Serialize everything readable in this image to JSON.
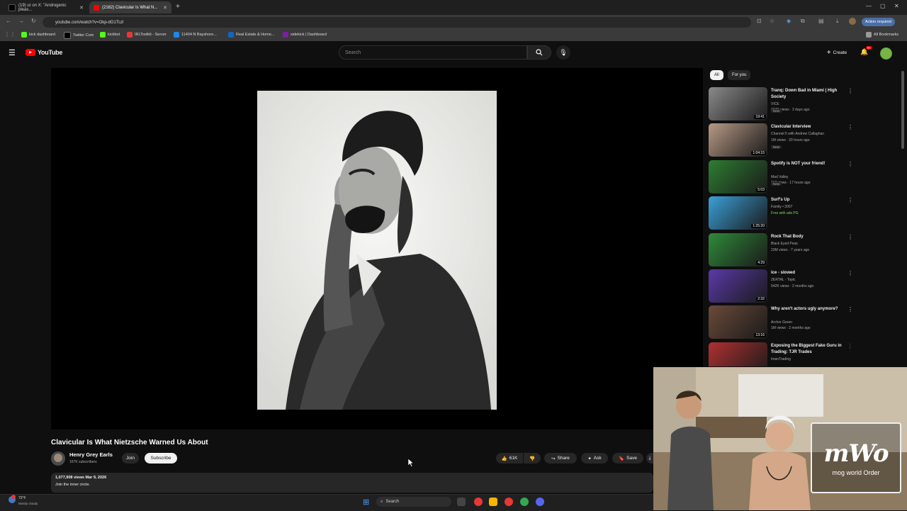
{
  "browser": {
    "tabs": [
      {
        "label": "(19) ur on X: \"Androgenic pleas...",
        "icon": "x-icon",
        "active": false
      },
      {
        "label": "(2162) Clavicular Is What N...",
        "icon": "youtube-icon",
        "active": true
      }
    ],
    "new_tab": "+",
    "url": "youtube.com/watch?v=Okp-dG1Tczl",
    "action_required": "Action required",
    "all_bookmarks": "All Bookmarks",
    "bookmarks": [
      "kick dashboard",
      "Twitter Com",
      "kickbot",
      "IRLToolkit - Server",
      "11404 N Bayshore...",
      "Real Estate & Home...",
      "sidekick | Dashboard"
    ]
  },
  "youtube": {
    "logo_text": "YouTube",
    "search_placeholder": "Search",
    "create_label": "Create",
    "notif_count": "9+"
  },
  "video": {
    "title": "Clavicular Is What Nietzsche Warned Us About",
    "channel": "Henry Grey Earls",
    "subscribers": "167K subscribers",
    "join": "Join",
    "subscribe": "Subscribe",
    "likes": "61K",
    "share": "Share",
    "ask": "Ask",
    "save": "Save",
    "stats": "1,077,908 views  Mar 9, 2026",
    "description": "Join the inner circle."
  },
  "sidebar": {
    "filters": [
      "All",
      "For you"
    ],
    "recommendations": [
      {
        "title": "Tranq: Down Bad in Miami | High Society",
        "channel": "VICE",
        "meta": "404K views · 2 days ago",
        "badge": "New",
        "duration": "19:41",
        "color": "#8a8a8a"
      },
      {
        "title": "Clavicular Interview",
        "channel": "Channel 5 with Andrew Callaghan",
        "meta": "1M views · 20 hours ago",
        "badge": "New",
        "duration": "1:04:15",
        "color": "#b89a86"
      },
      {
        "title": "Spotify is NOT your friend!",
        "channel": "Mad Valley",
        "meta": "113 views · 17 hours ago",
        "badge": "New",
        "duration": "5:03",
        "color": "#2e7d32"
      },
      {
        "title": "Surf's Up",
        "channel": "Family • 2007",
        "meta": "Free with ads  PG",
        "badge": "",
        "duration": "1:25:20",
        "color": "#3aa0d8"
      },
      {
        "title": "Rock That Body",
        "channel": "Black Eyed Peas",
        "meta": "23M views · 7 years ago",
        "badge": "",
        "duration": "4:29",
        "color": "#2f8a3a"
      },
      {
        "title": "ice - slowed",
        "channel": "ZERTAL - Topic",
        "meta": "542K views · 2 months ago",
        "badge": "",
        "duration": "2:32",
        "color": "#5a3aa8"
      },
      {
        "title": "Why aren't actors ugly anymore?",
        "channel": "Archer Green",
        "meta": "1M views · 2 months ago",
        "badge": "",
        "duration": "13:16",
        "color": "#6b4a3a"
      },
      {
        "title": "Exposing the Biggest Fake Guru in Trading: TJR Trades",
        "channel": "ImanTrading",
        "meta": "",
        "badge": "",
        "duration": "",
        "color": "#b03030"
      }
    ]
  },
  "overlay": {
    "logo_text": "mWo",
    "logo_sub": "mog world Order"
  },
  "taskbar": {
    "weather_temp": "72°F",
    "weather_desc": "Mostly cloudy",
    "search": "Search"
  }
}
